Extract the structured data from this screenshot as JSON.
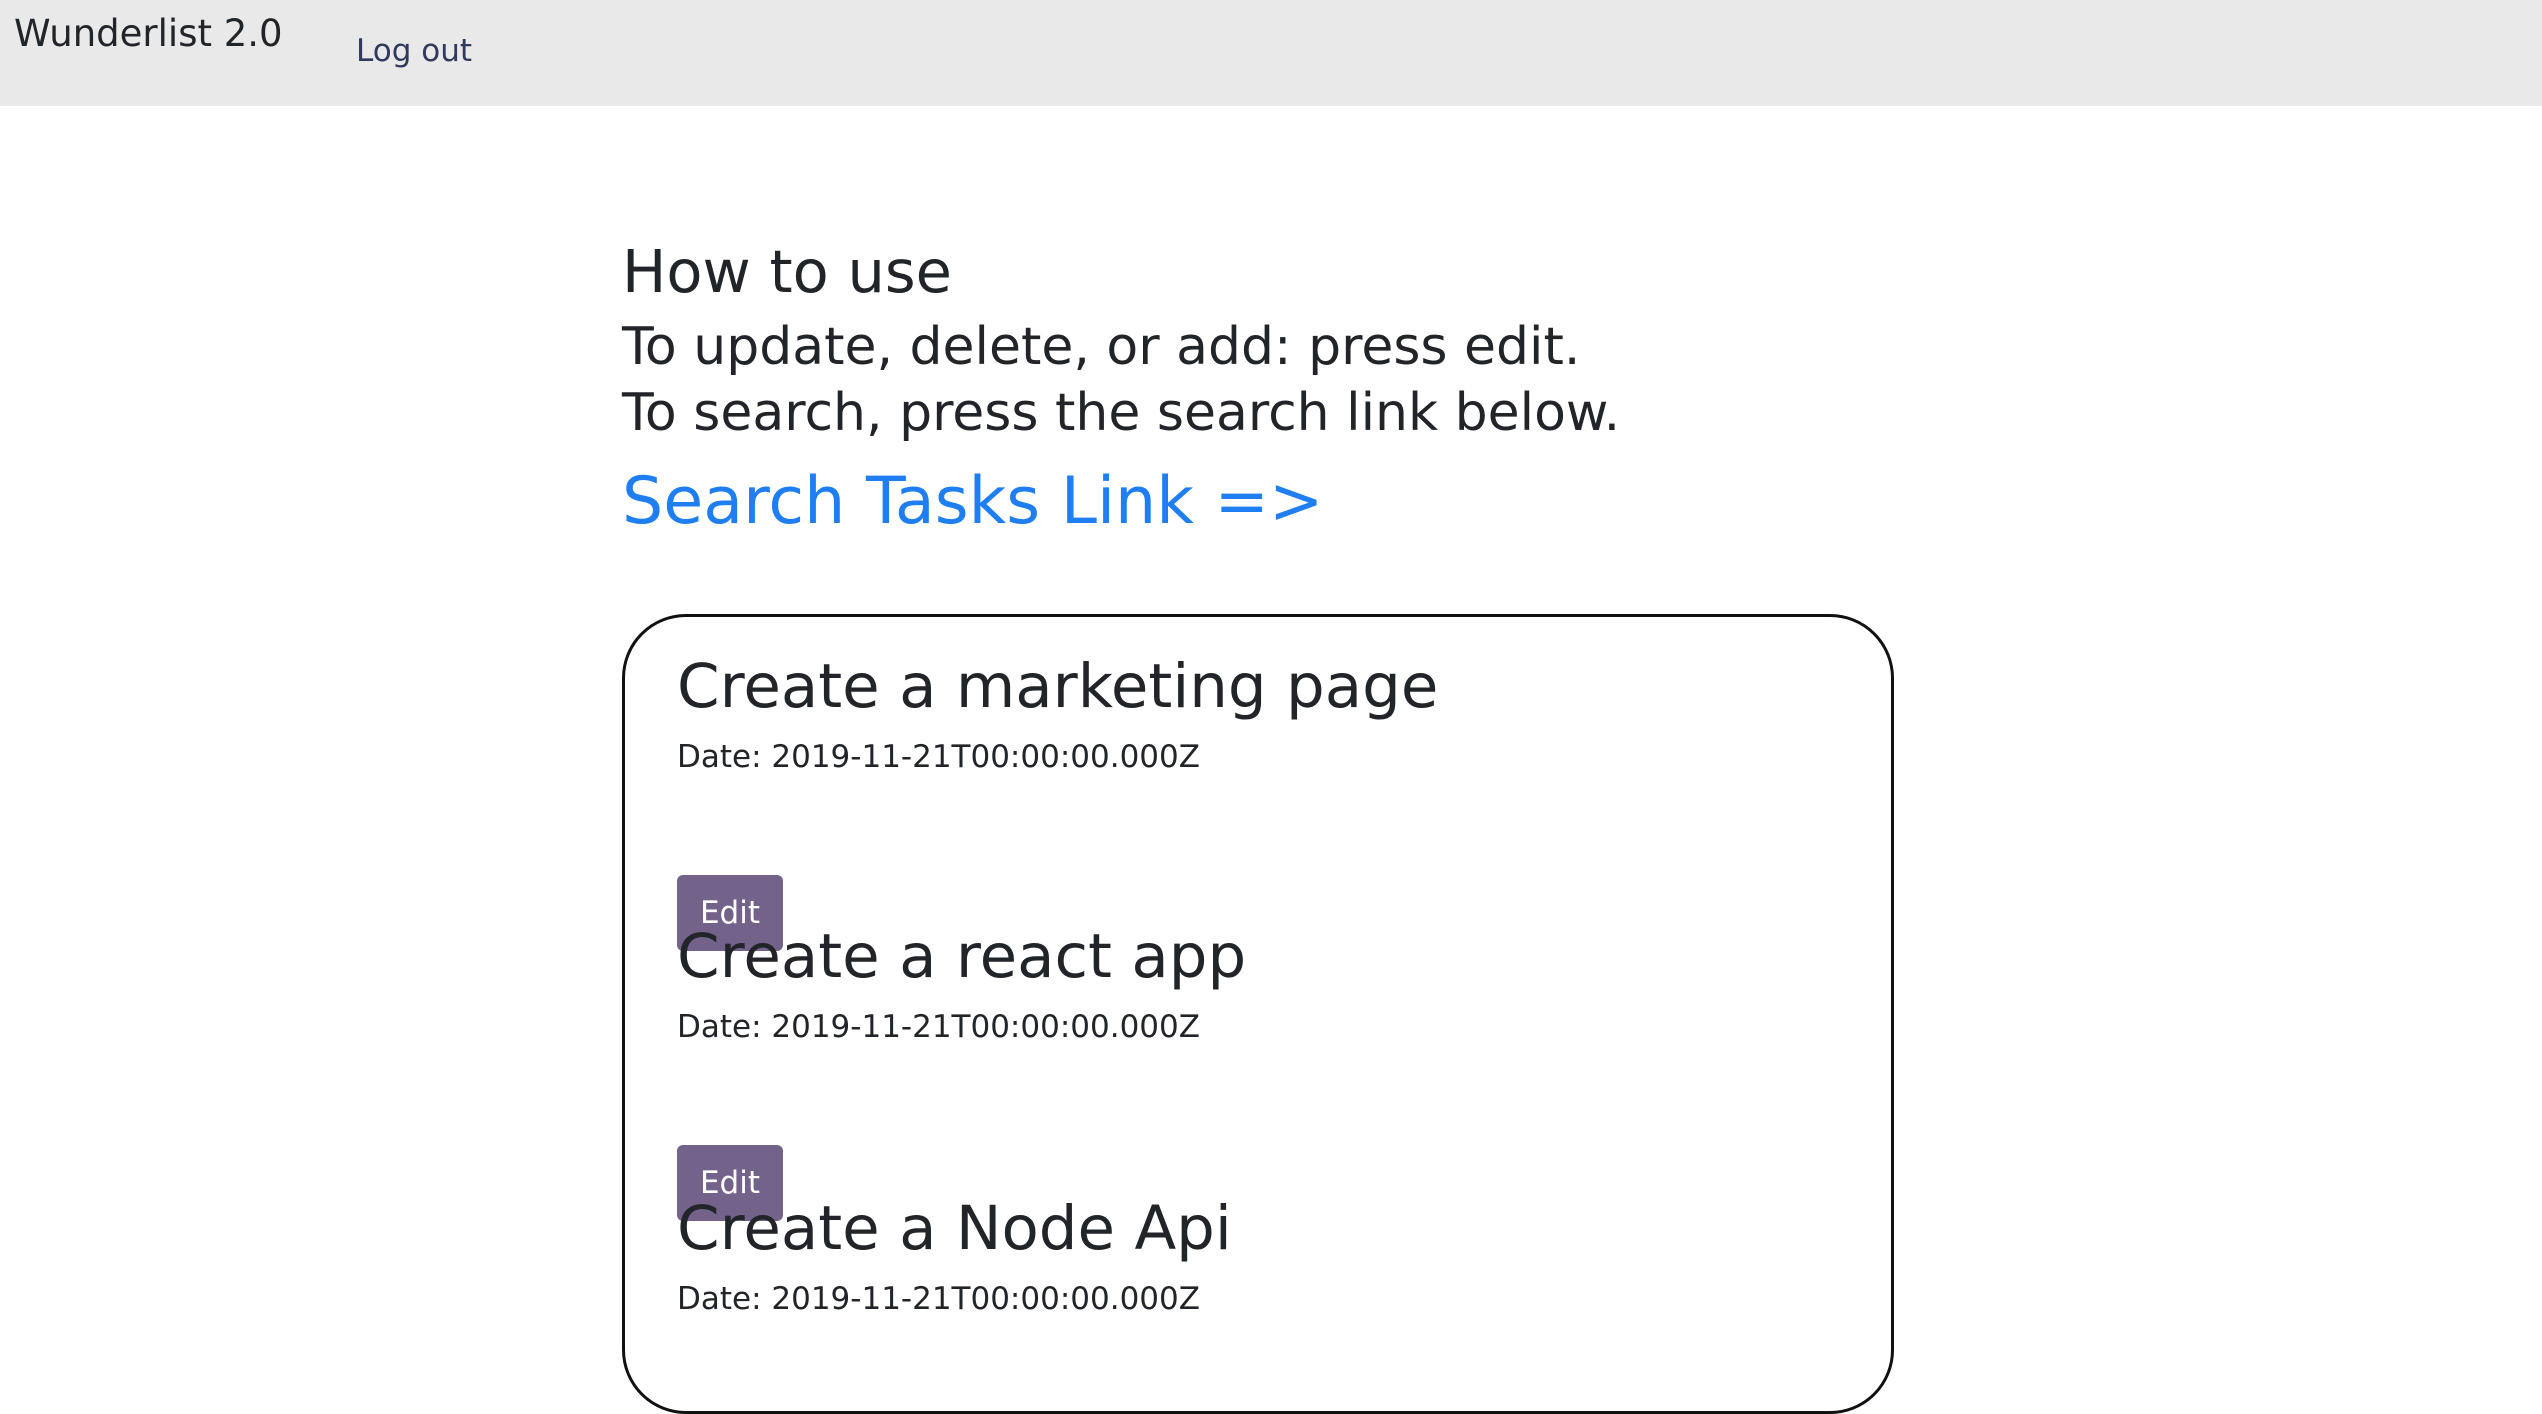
{
  "navbar": {
    "brand": "Wunderlist 2.0",
    "logout_label": "Log out",
    "background": "#e9e9e9"
  },
  "instructions": {
    "title": "How to use",
    "line1": "To update, delete, or add: press edit.",
    "line2": "To search, press the search link below.",
    "search_link_label": "Search Tasks Link =>",
    "link_color": "#1e7ef2"
  },
  "tasks": [
    {
      "title": "Create a marketing page",
      "date": "Date: 2019-11-21T00:00:00.000Z",
      "edit_label": "Edit"
    },
    {
      "title": "Create a react app",
      "date": "Date: 2019-11-21T00:00:00.000Z",
      "edit_label": "Edit"
    },
    {
      "title": "Create a Node Api",
      "date": "Date: 2019-11-21T00:00:00.000Z",
      "edit_label": "Edit"
    }
  ],
  "colors": {
    "edit_button": "#73628a",
    "text": "#212529"
  }
}
